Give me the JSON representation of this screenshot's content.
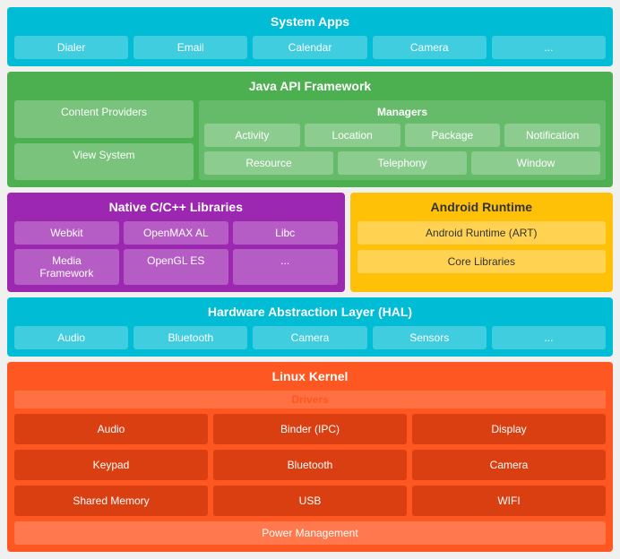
{
  "system_apps": {
    "title": "System Apps",
    "items": [
      "Dialer",
      "Email",
      "Calendar",
      "Camera",
      "..."
    ]
  },
  "java_framework": {
    "title": "Java API Framework",
    "left": {
      "content_providers": "Content Providers",
      "view_system": "View System"
    },
    "managers": {
      "title": "Managers",
      "row1": [
        "Activity",
        "Location",
        "Package",
        "Notification"
      ],
      "row2": [
        "Resource",
        "Telephony",
        "Window"
      ]
    }
  },
  "native": {
    "title": "Native C/C++ Libraries",
    "items": [
      "Webkit",
      "OpenMAX AL",
      "Libc",
      "Media Framework",
      "OpenGL ES",
      "..."
    ]
  },
  "android_runtime": {
    "title": "Android Runtime",
    "items": [
      "Android Runtime (ART)",
      "Core Libraries"
    ]
  },
  "hal": {
    "title": "Hardware Abstraction Layer (HAL)",
    "items": [
      "Audio",
      "Bluetooth",
      "Camera",
      "Sensors",
      "..."
    ]
  },
  "linux_kernel": {
    "title": "Linux Kernel",
    "drivers_title": "Drivers",
    "drivers": [
      "Audio",
      "Binder (IPC)",
      "Display",
      "Keypad",
      "Bluetooth",
      "Camera",
      "Shared Memory",
      "USB",
      "WIFI"
    ],
    "power_management": "Power Management"
  }
}
